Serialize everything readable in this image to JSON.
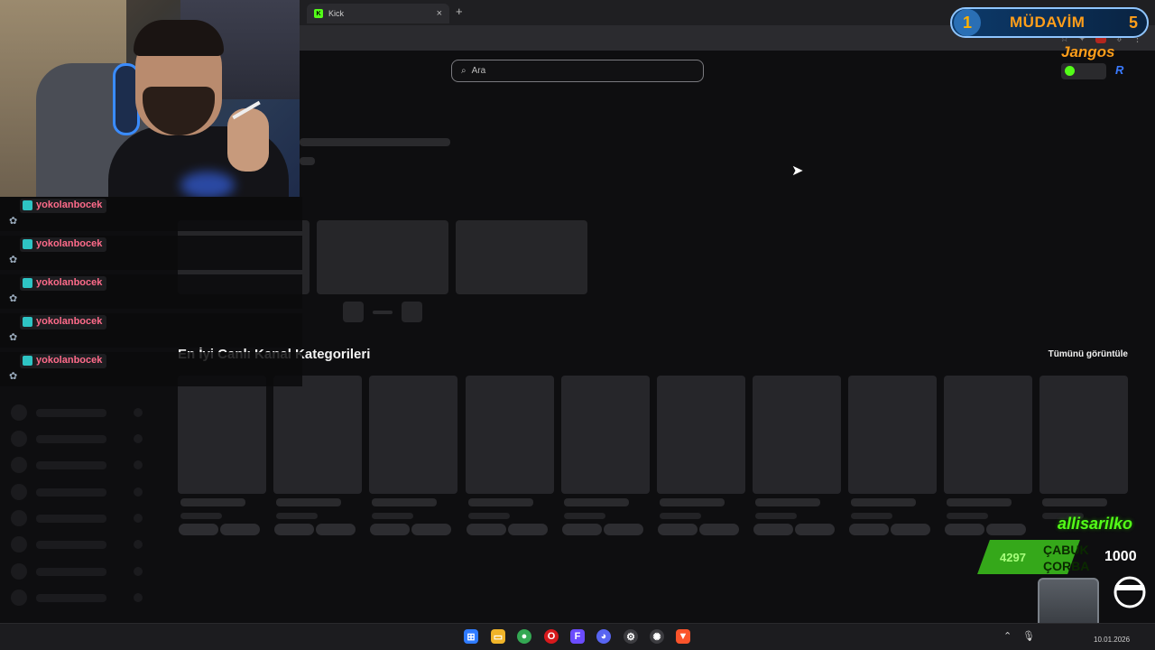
{
  "browser": {
    "tab_title": "Kick",
    "tab_favicon": "K",
    "tab_close": "×",
    "new_tab": "+"
  },
  "page": {
    "search_placeholder": "Ara",
    "section_title": "En İyi Canlı Kanal Kategorileri",
    "view_all": "Tümünü görüntüle"
  },
  "chat": {
    "messages": [
      {
        "user": "yokolanbocek"
      },
      {
        "user": "yokolanbocek"
      },
      {
        "user": "yokolanbocek"
      },
      {
        "user": "yokolanbocek"
      },
      {
        "user": "yokolanbocek"
      }
    ]
  },
  "overlay": {
    "loyalty_rank": "1",
    "loyalty_title": "MÜDAVİM",
    "loyalty_count": "5",
    "loyalty_user": "Jangos",
    "loyalty_r": "R",
    "alert_user": "allisarilko",
    "promo_count": "4297",
    "promo_text_1": "ÇABUK",
    "promo_text_2": "ÇORBA",
    "promo_amount": "1000"
  },
  "taskbar": {
    "clock": "10.01.2026"
  },
  "colors": {
    "kick_green": "#53fc18",
    "chat_name": "#ff6b8a",
    "loyalty_orange": "#ff9e1a"
  }
}
